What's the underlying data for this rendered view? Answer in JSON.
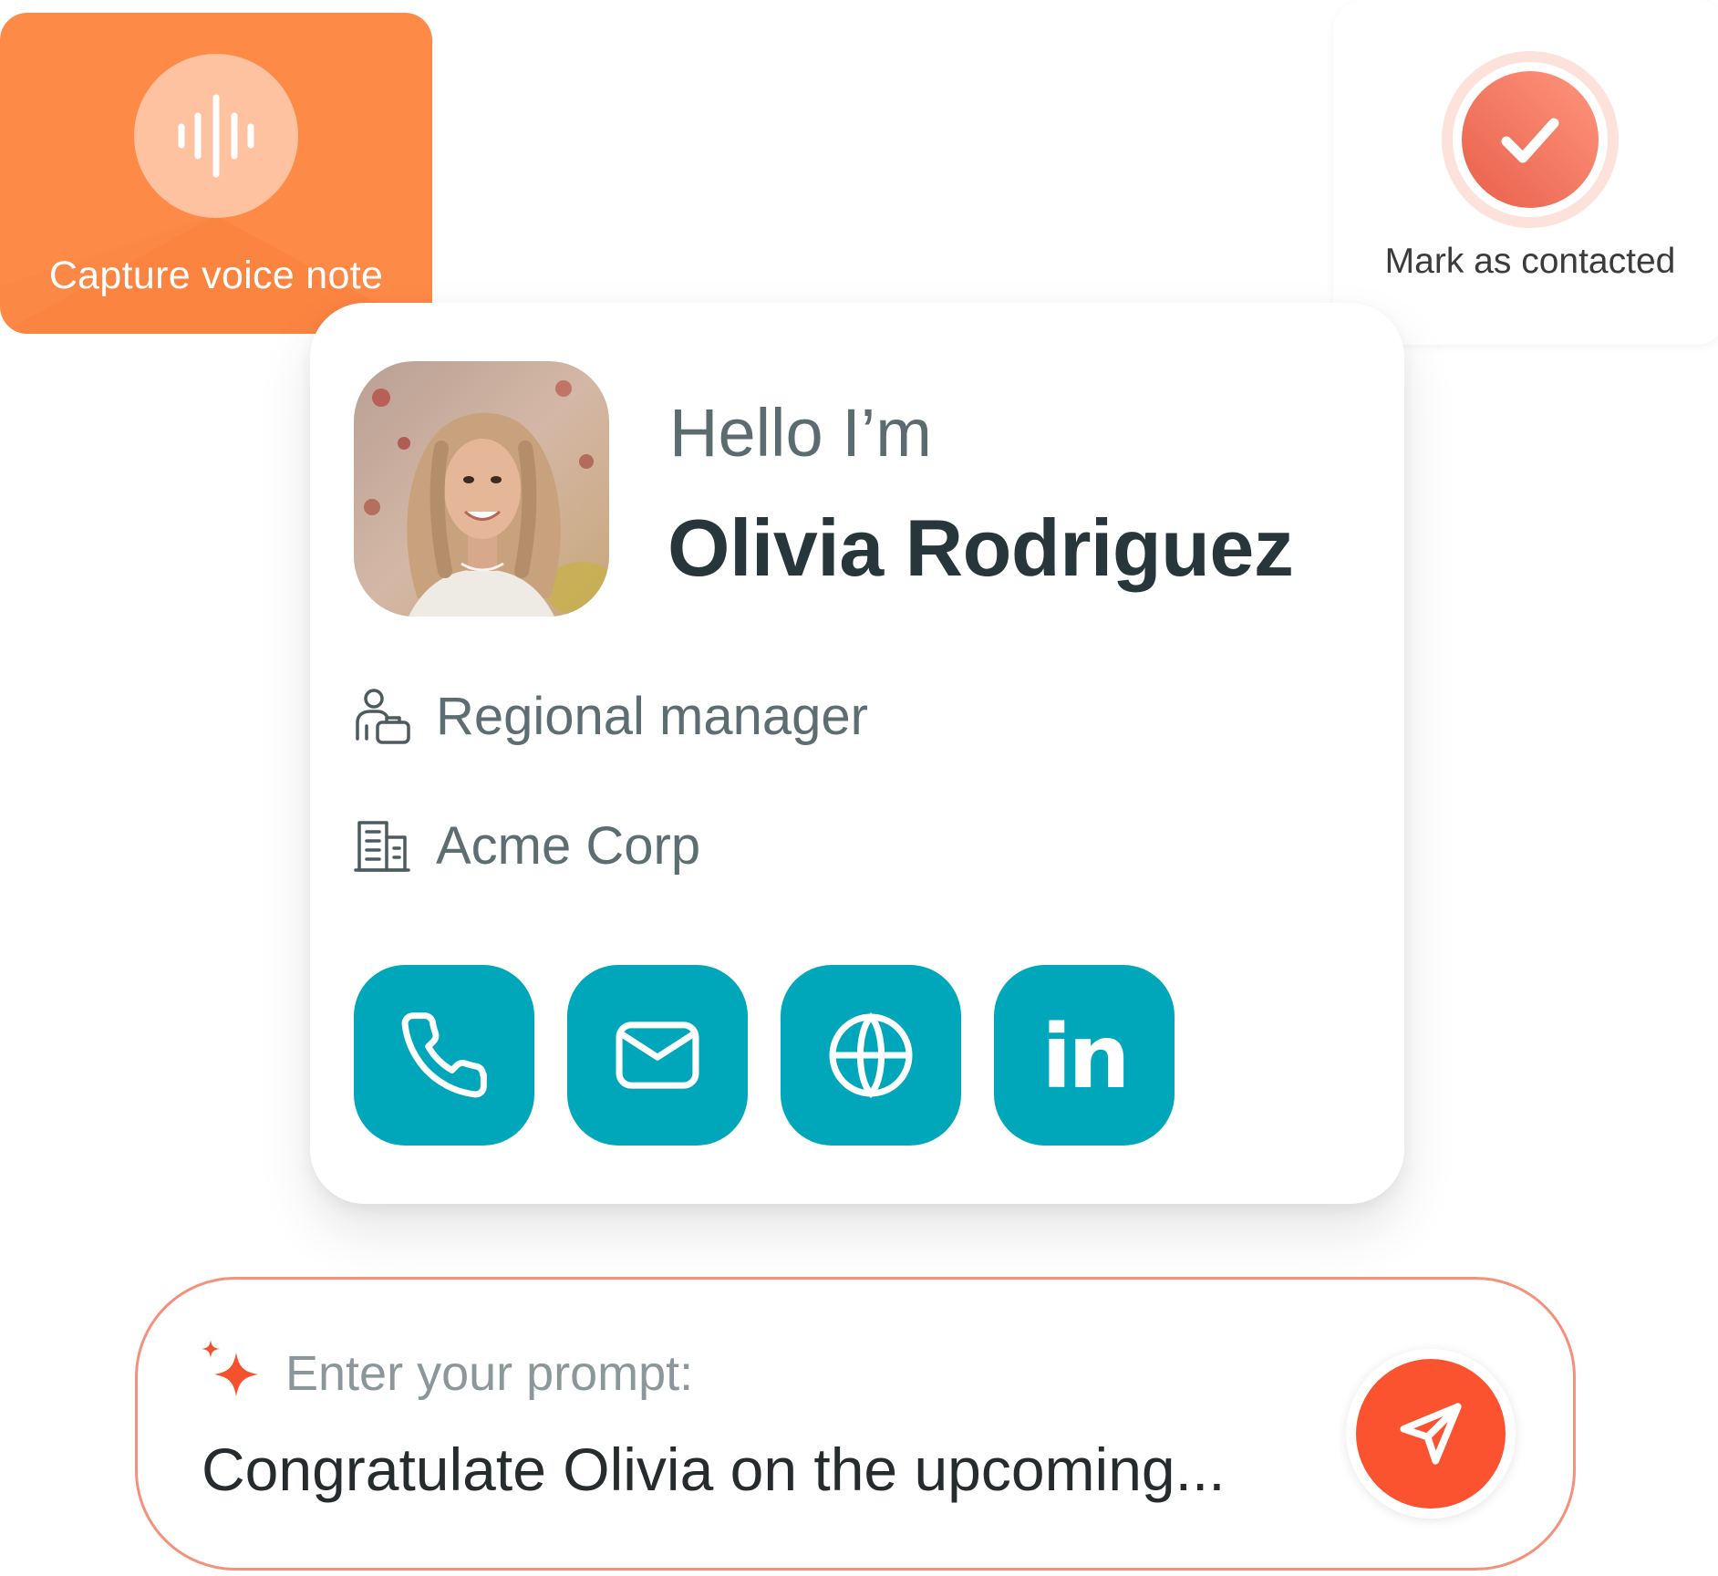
{
  "voice_note": {
    "label": "Capture voice note",
    "icon": "audio-wave-icon",
    "color": "#fe8a48"
  },
  "contacted": {
    "label": "Mark as contacted",
    "icon": "check-icon",
    "color": "#e8604a"
  },
  "profile": {
    "greeting": "Hello I’m",
    "name": "Olivia Rodriguez",
    "role": "Regional manager",
    "company": "Acme Corp",
    "role_icon": "person-briefcase-icon",
    "company_icon": "building-icon",
    "actions": [
      {
        "icon": "phone-icon"
      },
      {
        "icon": "mail-icon"
      },
      {
        "icon": "globe-icon"
      },
      {
        "icon": "linkedin-icon",
        "text": "in"
      }
    ],
    "accent": "#00a6b9"
  },
  "prompt": {
    "label": "Enter your prompt:",
    "value": "Congratulate Olivia on the upcoming...",
    "send_icon": "send-icon",
    "send_color": "#fb5230",
    "border_color": "#f5917b"
  }
}
